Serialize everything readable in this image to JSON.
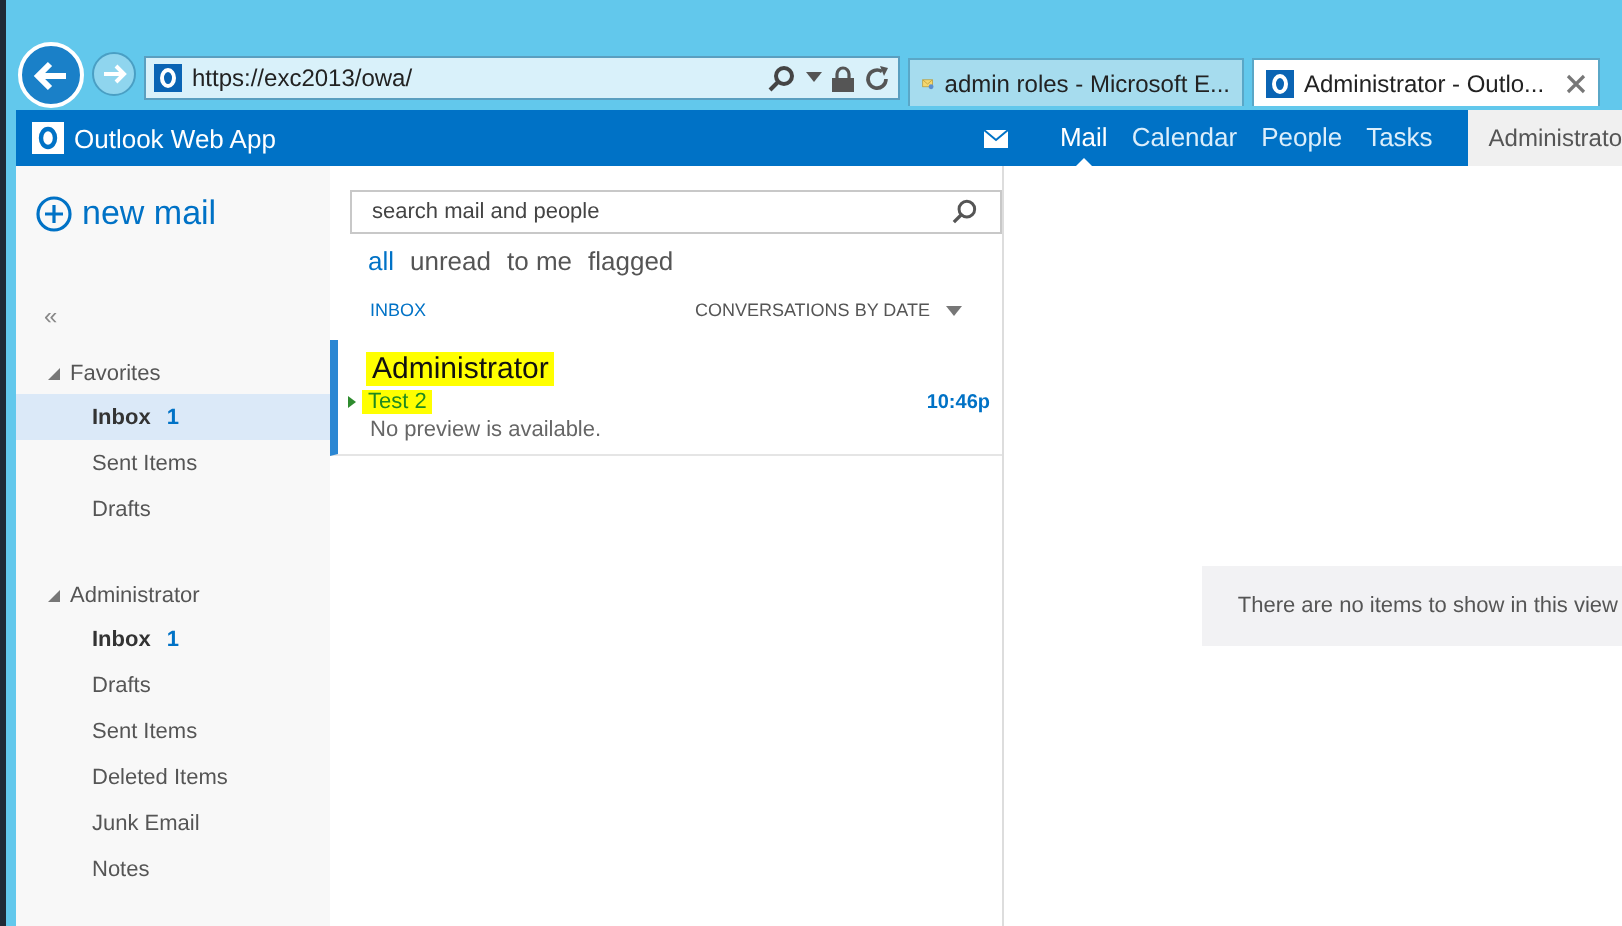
{
  "browser": {
    "address": "https://exc2013/owa/",
    "tabs": [
      {
        "title": "admin roles - Microsoft E...",
        "selected": false,
        "kind": "exchange"
      },
      {
        "title": "Administrator - Outlo...",
        "selected": true,
        "kind": "outlook"
      }
    ]
  },
  "app": {
    "title": "Outlook Web App",
    "nav": [
      {
        "label": "Mail",
        "selected": true
      },
      {
        "label": "Calendar",
        "selected": false
      },
      {
        "label": "People",
        "selected": false
      },
      {
        "label": "Tasks",
        "selected": false
      }
    ],
    "user": "Administrato"
  },
  "new_mail": "new mail",
  "search": {
    "placeholder": "search mail and people"
  },
  "filters": [
    {
      "label": "all",
      "selected": true
    },
    {
      "label": "unread",
      "selected": false
    },
    {
      "label": "to me",
      "selected": false
    },
    {
      "label": "flagged",
      "selected": false
    }
  ],
  "collapse": "«",
  "folder_groups": [
    {
      "label": "Favorites",
      "expanded": true,
      "items": [
        {
          "label": "Inbox",
          "count": "1",
          "selected": true
        },
        {
          "label": "Sent Items",
          "selected": false
        },
        {
          "label": "Drafts",
          "selected": false
        }
      ]
    },
    {
      "label": "Administrator",
      "expanded": true,
      "items": [
        {
          "label": "Inbox",
          "count": "1",
          "selected": false
        },
        {
          "label": "Drafts",
          "selected": false
        },
        {
          "label": "Sent Items",
          "selected": false
        },
        {
          "label": "Deleted Items",
          "selected": false
        },
        {
          "label": "Junk Email",
          "selected": false
        },
        {
          "label": "Notes",
          "selected": false
        }
      ]
    }
  ],
  "list": {
    "folder": "INBOX",
    "sort": "CONVERSATIONS BY DATE",
    "messages": [
      {
        "sender": "Administrator",
        "subject": "Test 2",
        "preview": "No preview is available.",
        "time": "10:46p",
        "selected": true,
        "highlighted": true
      }
    ]
  },
  "reading_pane": {
    "message": "There are no items to show in this view"
  }
}
